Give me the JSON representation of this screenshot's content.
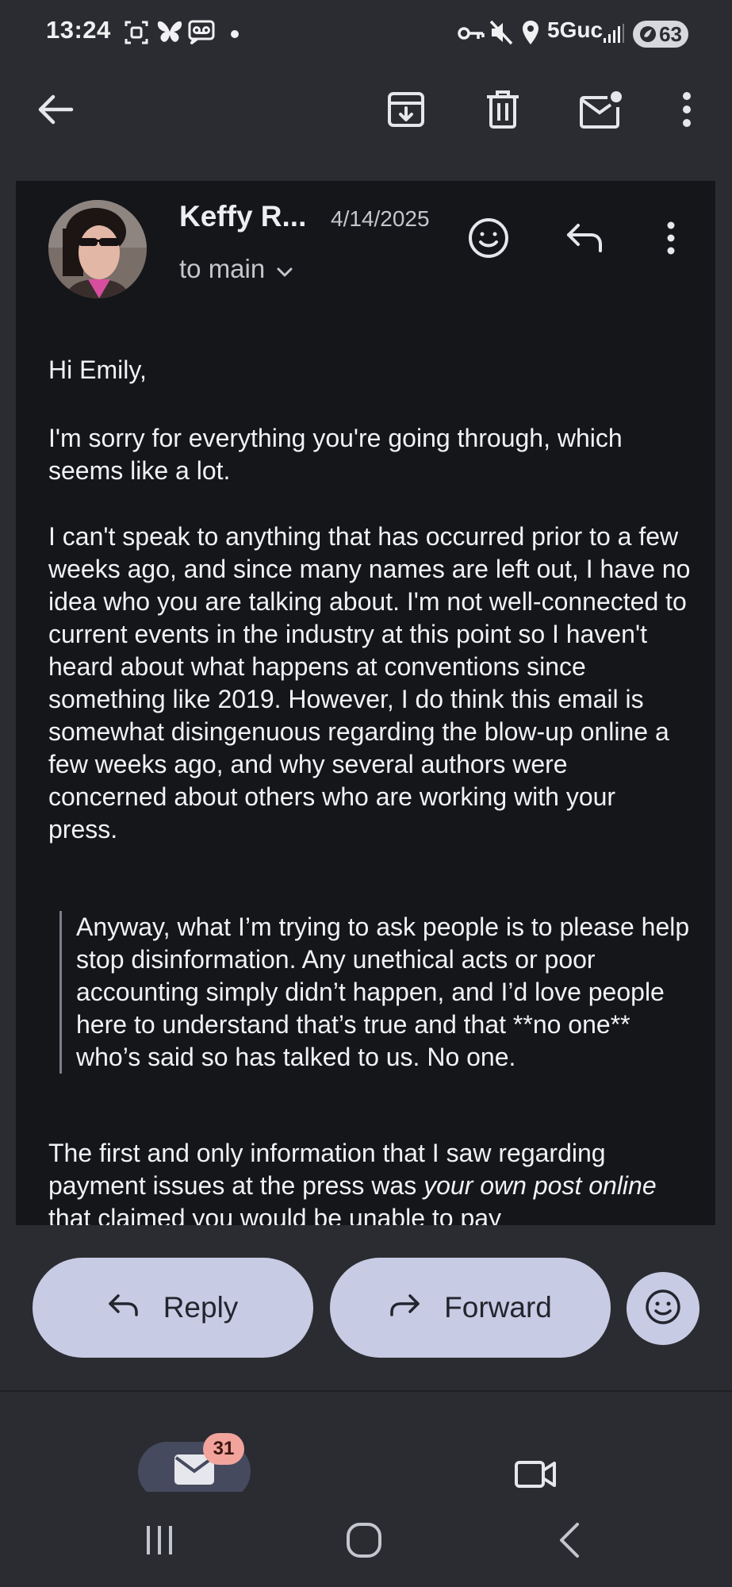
{
  "status_bar": {
    "time": "13:24",
    "network": "5Guc",
    "battery": "63",
    "icons": [
      "screenshot-icon",
      "butterfly-icon",
      "voicemail-icon",
      "dot-icon",
      "key-icon",
      "mute-icon",
      "location-icon",
      "signal-icon"
    ]
  },
  "app_bar": {
    "icons": [
      "back-arrow-icon",
      "archive-icon",
      "delete-icon",
      "mark-unread-icon",
      "more-vert-icon"
    ]
  },
  "email": {
    "sender": "Keffy R...",
    "date": "4/14/2025",
    "recipients": "to main",
    "greeting": "Hi Emily,",
    "para1": "I'm sorry for everything you're going through, which seems like a lot.",
    "para2": "I can't speak to anything that has occurred prior to a few weeks ago, and since many names are left out, I have no idea who you are talking about. I'm not well-connected to current events in the industry at this point so I haven't heard about what happens at conventions since something like 2019. However, I do think this email is somewhat disingenuous regarding the blow-up online a few weeks ago, and why several authors were concerned about others who are working with your press.",
    "quote": "Anyway, what I’m trying to ask people is to please help stop disinformation. Any unethical acts or poor accounting simply didn’t happen, and I’d love people here to understand that’s true and that **no one** who’s said so has talked to us. No one.",
    "para3_start": "The first and only information that I saw regarding payment issues at the press was ",
    "para3_italic": "your own post online",
    "para3_end": " that claimed you would be unable to pay"
  },
  "actions": {
    "reply_label": "Reply",
    "forward_label": "Forward"
  },
  "bottom_nav": {
    "mail_badge": "31"
  },
  "colors": {
    "background": "#2b2c31",
    "card": "#15161a",
    "pill": "#c8cbe4",
    "badge": "#f2a49c"
  }
}
